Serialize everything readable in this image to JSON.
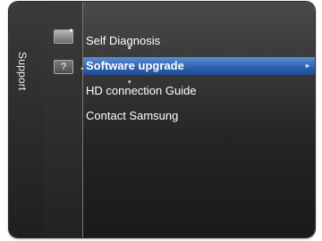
{
  "sidebar": {
    "section_title": "Support"
  },
  "menu": {
    "items": [
      {
        "label": "Self Diagnosis",
        "selected": false
      },
      {
        "label": "Software upgrade",
        "selected": true
      },
      {
        "label": "HD connection Guide",
        "selected": false
      },
      {
        "label": "Contact Samsung",
        "selected": false
      }
    ]
  },
  "icons": {
    "top": "tools-icon",
    "help": "help-icon"
  },
  "colors": {
    "selection": "#2f63b0",
    "background": "#242424"
  }
}
